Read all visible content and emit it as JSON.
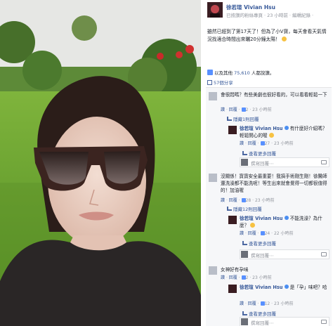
{
  "post": {
    "author": "徐若瑄 Vivian Hsu",
    "subtitle": [
      "已按讚的粉絲專頁",
      "·",
      "23 小時前",
      "·",
      "編輯紀錄",
      "·"
    ],
    "text": "雖然已經到了第17天了！但為了小V寶，每天會看天氣情況找適合時間出來曬20分鐘太陽！",
    "likes_prefix": "以及其他",
    "likes_count": "75,610",
    "likes_suffix": "人都說讚。",
    "shares": "57個分享"
  },
  "comments": [
    {
      "text": "會很悶嗎？有些美劇也很好看的，可以看看輕鬆一下",
      "meta": [
        "讚",
        "·",
        "回覆",
        "·",
        "2",
        "·",
        "23 小時前"
      ],
      "hide_replies": "隱藏1則回覆",
      "reply": {
        "author": "徐若瑄 Vivian Hsu",
        "text": "有什麼好介紹嗎？輕鬆開心的喔",
        "meta": [
          "讚",
          "·",
          "回覆",
          "·",
          "27",
          "·",
          "23 小時前"
        ]
      },
      "reply_placeholder": "撰寫回覆⋯"
    },
    {
      "text": "沒關係！寶寶安全最重要！我搞手術剛生剛！徐醫師還洗澡都不能洗呢！等生出來就會覺得一切都很值得的！加油喔",
      "meta": [
        "讚",
        "·",
        "回覆",
        "·",
        "28",
        "·",
        "23 小時前"
      ],
      "hide_replies": "隱藏12則回覆",
      "reply": {
        "author": "徐若瑄 Vivian Hsu",
        "text": "不能洗澡？為什麼？",
        "meta": [
          "讚",
          "·",
          "回覆",
          "·",
          "24",
          "·",
          "22 小時前"
        ]
      },
      "more_replies": "查看更多回覆",
      "reply_placeholder": "撰寫回覆⋯"
    },
    {
      "text": "女神好有孕味",
      "meta": [
        "讚",
        "·",
        "回覆",
        "·",
        "2",
        "·",
        "23 小時前"
      ],
      "reply": {
        "author": "徐若瑄 Vivian Hsu",
        "text": "是「孕」味吧？哈",
        "meta": [
          "讚",
          "·",
          "回覆",
          "·",
          "12",
          "·",
          "23 小時前"
        ]
      },
      "more_replies": "查看更多回覆",
      "reply_placeholder": "撰寫回覆⋯"
    }
  ],
  "top_more_replies": "查看更多回覆",
  "colors": {
    "link": "#365899",
    "meta": "#90949c",
    "comment_bg": "#f6f7f9"
  },
  "icons": [
    "avatar",
    "like-icon",
    "share-icon",
    "reply-arrow-icon",
    "camera-icon",
    "verified-badge-icon",
    "emoji-icon"
  ]
}
